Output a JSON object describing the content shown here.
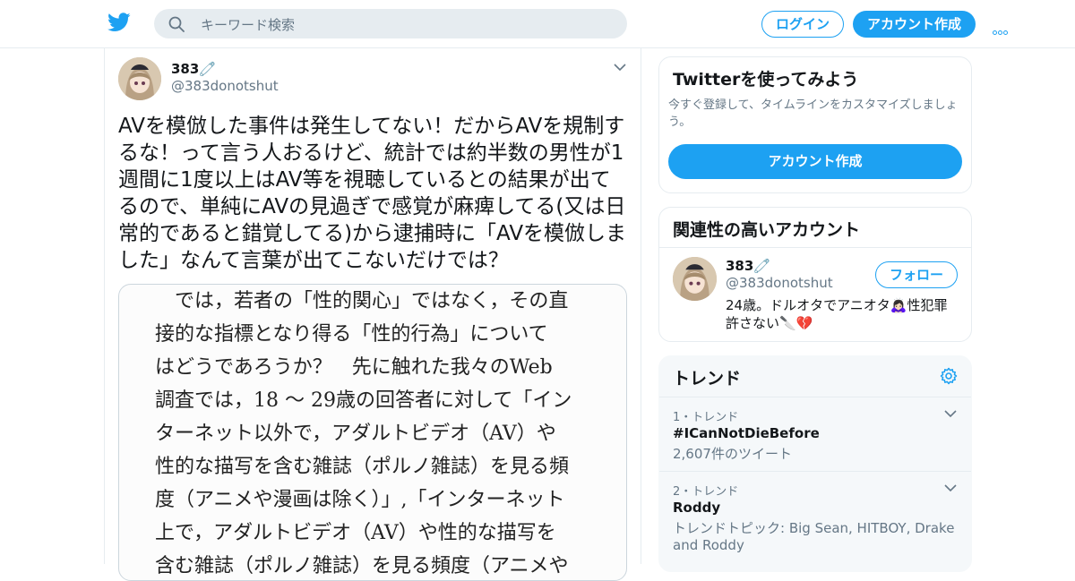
{
  "header": {
    "search_placeholder": "キーワード検索",
    "login_label": "ログイン",
    "signup_label": "アカウント作成",
    "brand_color": "#1da1f2"
  },
  "tweet": {
    "name": "383🧷",
    "handle": "@383donotshut",
    "text": "AVを模倣した事件は発生してない！だからAVを規制するな！って言う人おるけど、統計では約半数の男性が1週間に1度以上はAV等を視聴しているとの結果が出てるので、単純にAVの見過ぎで感覚が麻痺してる(又は日常的であると錯覚してる)から逮捕時に「AVを模倣しました」なんて言葉が出てこないだけでは？",
    "media_text": "　では，若者の「性的関心」ではなく，その直\n接的な指標となり得る「性的行為」について\nはどうであろうか？　先に触れた我々のWeb\n調査では，18 ～ 29歳の回答者に対して「イン\nターネット以外で，アダルトビデオ（AV）や\n性的な描写を含む雑誌（ポルノ雑誌）を見る頻\n度（アニメや漫画は除く）」,「インターネット\n上で，アダルトビデオ（AV）や性的な描写を\n含む雑誌（ポルノ雑誌）を見る頻度（アニメや"
  },
  "signup_card": {
    "title": "Twitterを使ってみよう",
    "subtitle": "今すぐ登録して、タイムラインをカスタマイズしましょう。",
    "cta": "アカウント作成"
  },
  "related": {
    "title": "関連性の高いアカウント",
    "name": "383🧷",
    "handle": "@383donotshut",
    "follow_label": "フォロー",
    "bio": "24歳。ドルオタでアニオタ🙇🏻‍♀️性犯罪許さない🔪💔"
  },
  "trends": {
    "title": "トレンド",
    "items": [
      {
        "meta": "1・トレンド",
        "name": "#ICanNotDieBefore",
        "count": "2,607件のツイート"
      },
      {
        "meta": "2・トレンド",
        "name": "Roddy",
        "count": "トレンドトピック: Big Sean, HITBOY, Drake and Roddy"
      }
    ]
  }
}
